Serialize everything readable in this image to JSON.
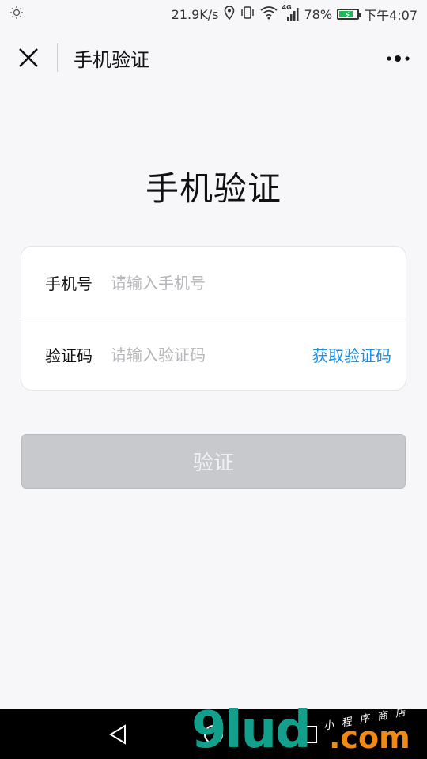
{
  "status_bar": {
    "network_speed": "21.9K/s",
    "network_type": "4G",
    "battery_percent": "78%",
    "battery_level": 0.78,
    "time": "下午4:07",
    "icons": [
      "brightness-icon",
      "location-icon",
      "vibrate-icon",
      "wifi-icon",
      "signal-icon",
      "battery-icon"
    ]
  },
  "nav": {
    "title": "手机验证"
  },
  "main": {
    "title": "手机验证"
  },
  "form": {
    "phone_label": "手机号",
    "phone_value": "",
    "phone_placeholder": "请输入手机号",
    "code_label": "验证码",
    "code_value": "",
    "code_placeholder": "请输入验证码",
    "get_code_label": "获取验证码"
  },
  "verify_button": {
    "label": "验证"
  },
  "watermark": {
    "brand": "9lud",
    "suffix": ".com",
    "tagline": "小程序商店"
  },
  "colors": {
    "background": "#f7f7f9",
    "link_blue": "#1a8fe3",
    "button_disabled": "#c8c9cc",
    "battery_green": "#1db954"
  }
}
